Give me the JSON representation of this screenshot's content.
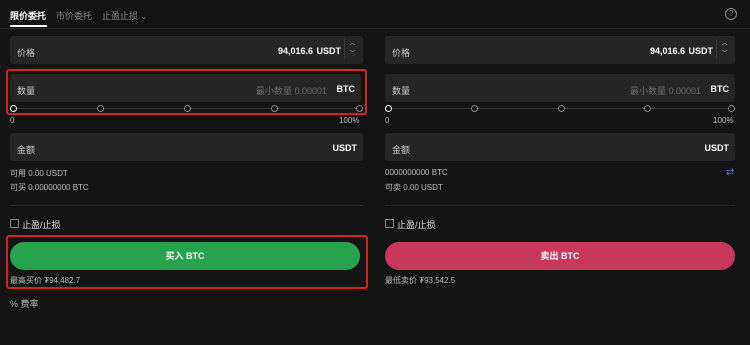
{
  "tabs": {
    "limit": "限价委托",
    "market": "市价委托",
    "stop": "止盈止损",
    "help_icon": "question-icon"
  },
  "buy": {
    "price_label": "价格",
    "price_value": "94,016.6",
    "price_unit": "USDT",
    "qty_label": "数量",
    "qty_placeholder": "最小数量 0.00001",
    "qty_unit": "BTC",
    "slider_min": "0",
    "slider_max": "100%",
    "slider_level": 0,
    "amount_label": "金额",
    "amount_unit": "USDT",
    "available": "可用 0.00 USDT",
    "can_buy": "可买 0.00000000 BTC",
    "tpsl_label": "止盈/止损",
    "button_label": "买入 BTC",
    "best_price": "最高买价 ₮94,482.7",
    "fee_label": "费率"
  },
  "sell": {
    "price_label": "价格",
    "price_value": "94,016.6",
    "price_unit": "USDT",
    "qty_label": "数量",
    "qty_placeholder": "最小数量 0.00001",
    "qty_unit": "BTC",
    "slider_min": "0",
    "slider_max": "100%",
    "slider_level": 0,
    "amount_label": "金额",
    "amount_unit": "USDT",
    "available": "0000000000 BTC",
    "can_sell": "可卖 0.00 USDT",
    "tpsl_label": "止盈/止损",
    "button_label": "卖出 BTC",
    "best_price": "最低卖价 ₮93,542.5"
  },
  "colors": {
    "buy": "#27a34d",
    "sell": "#c9375c",
    "highlight": "#d42525"
  }
}
